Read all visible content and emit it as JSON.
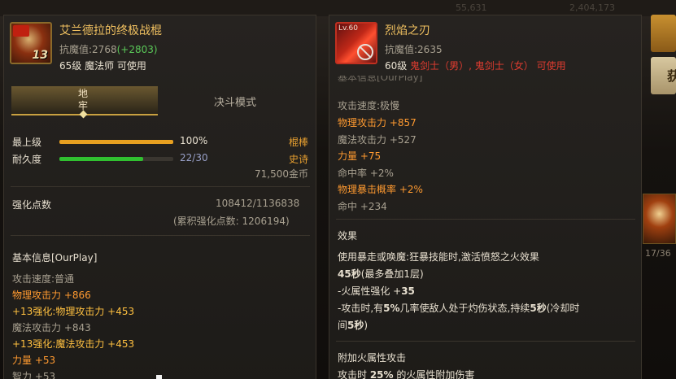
{
  "left": {
    "title": "艾兰德拉的终极战棍",
    "icon_level": "13",
    "resist_label": "抗魔值:2768",
    "resist_bonus": "(+2803)",
    "requirement": "65级 魔法师 可使用",
    "tabs": [
      "地牢",
      "决斗模式"
    ],
    "stats": {
      "max_level_label": "最上级",
      "max_level_value": "100%",
      "max_level_fraction": 1.0,
      "durability_label": "耐久度",
      "durability_value": "22/30",
      "durability_fraction": 0.733,
      "weapon_type": "棍棒",
      "rarity": "史诗",
      "price": "71,500金币"
    },
    "enhance": {
      "label": "强化点数",
      "value": "108412/1136838",
      "cumulative": "(累积强化点数: 1206194)"
    },
    "basic_info": {
      "header": "基本信息[OurPlay]",
      "lines": [
        {
          "text": "攻击速度:普通",
          "style": "grey"
        },
        {
          "text": "物理攻击力 +866",
          "style": "orange"
        },
        {
          "text": "+13强化:物理攻击力 +453",
          "style": "yellow"
        },
        {
          "text": "魔法攻击力 +843",
          "style": "grey"
        },
        {
          "text": "+13强化:魔法攻击力 +453",
          "style": "yellow"
        },
        {
          "text": "力量 +53",
          "style": "orange"
        },
        {
          "text": "智力 +53",
          "style": "grey"
        }
      ]
    }
  },
  "right": {
    "title": "烈焰之刃",
    "icon_level": "Lv.60",
    "resist_label": "抗魔值:2635",
    "requirement_level": "60级",
    "requirement_classes": "鬼剑士（男）, 鬼剑士（女）",
    "requirement_suffix": "可使用",
    "partial_header": "基本信息[OurPlay]",
    "stats": [
      {
        "text": "攻击速度:极慢",
        "style": "grey"
      },
      {
        "text": "物理攻击力 +857",
        "style": "orange"
      },
      {
        "text": "魔法攻击力 +527",
        "style": "grey"
      },
      {
        "text": "力量 +75",
        "style": "orange"
      },
      {
        "text": "命中率 +2%",
        "style": "grey"
      },
      {
        "text": "物理暴击概率 +2%",
        "style": "orange"
      },
      {
        "text": "命中 +234",
        "style": "grey"
      }
    ],
    "effect": {
      "header": "效果",
      "line1": "使用暴走或唤魔:狂暴技能时,激活愤怒之火效果",
      "line2_bold": "45秒",
      "line2_rest": "(最多叠加1层)",
      "line3_prefix": "-火属性强化 +",
      "line3_value": "35",
      "line4_a": "-攻击时,有",
      "line4_b": "5%",
      "line4_c": "几率使敌人处于灼伤状态,持续",
      "line4_d": "5秒",
      "line4_e": "(冷却时",
      "line5_a": "间",
      "line5_b": "5秒",
      "line5_c": ")"
    },
    "fire": {
      "header": "附加火属性攻击",
      "line_a": "攻击时 ",
      "line_b": "25%",
      "line_c": " 的火属性附加伤害"
    }
  },
  "sidebar": {
    "button_label": "获",
    "counter_text": "17/36"
  },
  "topbar": {
    "ghost_text_1": "55,631",
    "ghost_text_2": "2,404,173"
  },
  "colors": {
    "title_gold": "#f0c060",
    "bonus_green": "#5ac858",
    "stat_orange": "#ff9a30",
    "enhance_yellow": "#ffc040",
    "class_red": "#e03c30"
  }
}
